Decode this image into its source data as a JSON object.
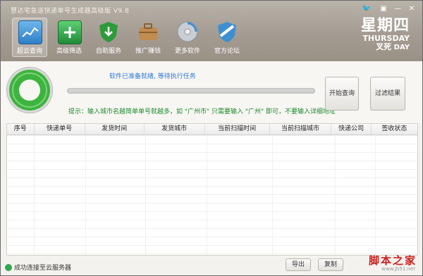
{
  "app": {
    "title": "慧达宅急送快递单号生成器高级版  V9.8"
  },
  "toolbar": [
    {
      "label": "超云查询",
      "icon": "monitor-chart-icon",
      "color": "#3b8fd6",
      "active": true
    },
    {
      "label": "高级筛选",
      "icon": "screen-plus-icon",
      "color": "#2f9a4a"
    },
    {
      "label": "自助服务",
      "icon": "shield-download-icon",
      "color": "#2c9b3a"
    },
    {
      "label": "推广赚钱",
      "icon": "briefcase-icon",
      "color": "#b8844a"
    },
    {
      "label": "更多软件",
      "icon": "disc-icon",
      "color": "#9aa0a6"
    },
    {
      "label": "官方论坛",
      "icon": "forum-shield-icon",
      "color": "#3f8fcf"
    }
  ],
  "date": {
    "weekday": "星期四",
    "english": "THURSDAY",
    "day": "DAY",
    "tag": "叉死"
  },
  "status_panel": {
    "ready_text": "软件已准备就绪, 等待执行任务",
    "hint": "提示：输入城市名越简单单号就越多，如 \"广州市\" 只需要输入 \"广州\" 即可，不要输入详细地址",
    "start_label": "开始查询",
    "filter_label": "过滤结果"
  },
  "table": {
    "columns": [
      "序号",
      "快递单号",
      "发货时间",
      "发货城市",
      "当前扫描时间",
      "当前扫描城市",
      "快递公司",
      "签收状态"
    ],
    "rows": []
  },
  "footer": {
    "status": "成功连接至云服务器",
    "export_label": "导出",
    "copy_label": "复制",
    "watermark": "脚本之家",
    "watermark_url": "www.jb51.net"
  }
}
